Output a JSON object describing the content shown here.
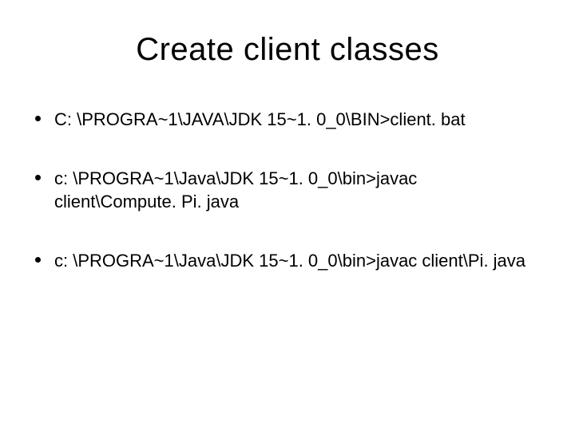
{
  "slide": {
    "title": "Create client classes",
    "bullets": [
      {
        "text": "C: \\PROGRA~1\\JAVA\\JDK 15~1. 0_0\\BIN>client. bat"
      },
      {
        "text": "c: \\PROGRA~1\\Java\\JDK 15~1. 0_0\\bin>javac client\\Compute. Pi. java"
      },
      {
        "text": "c: \\PROGRA~1\\Java\\JDK 15~1. 0_0\\bin>javac client\\Pi. java"
      }
    ]
  }
}
